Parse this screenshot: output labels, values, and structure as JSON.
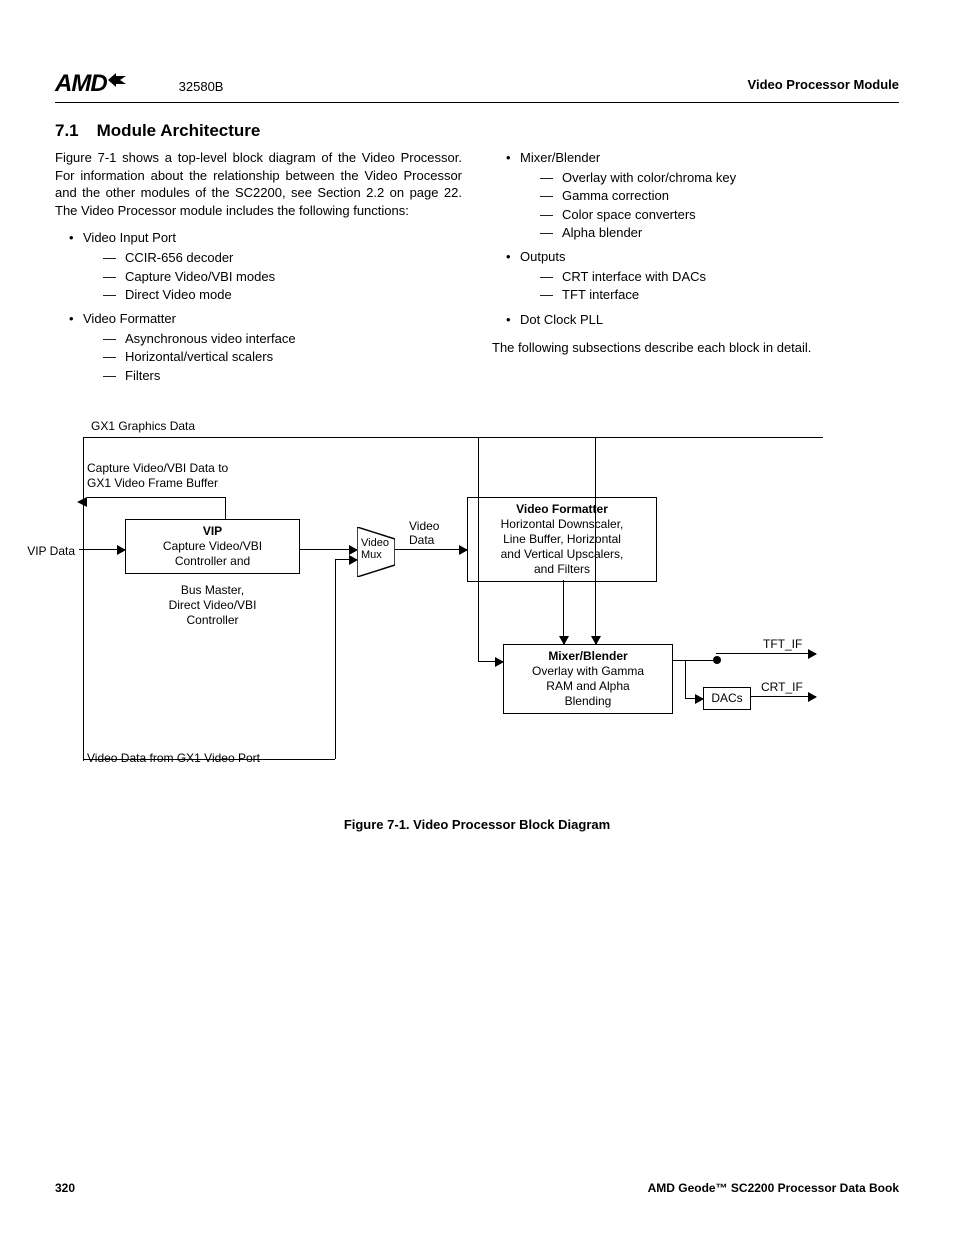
{
  "header": {
    "logo": "AMD",
    "docnum": "32580B",
    "module": "Video Processor Module"
  },
  "section": {
    "num": "7.1",
    "title": "Module Architecture",
    "intro": "Figure 7-1 shows a top-level block diagram of the Video Processor. For information about the relationship between the Video Processor and the other modules of the SC2200, see Section 2.2 on page 22. The Video Processor module includes the following functions:",
    "col1": [
      {
        "head": "Video Input Port",
        "subs": [
          "CCIR-656 decoder",
          "Capture Video/VBI modes",
          "Direct Video mode"
        ]
      },
      {
        "head": "Video Formatter",
        "subs": [
          "Asynchronous video interface",
          "Horizontal/vertical scalers",
          "Filters"
        ]
      }
    ],
    "col2": [
      {
        "head": "Mixer/Blender",
        "subs": [
          "Overlay with color/chroma key",
          "Gamma correction",
          "Color space converters",
          "Alpha blender"
        ]
      },
      {
        "head": "Outputs",
        "subs": [
          "CRT interface with DACs",
          "TFT interface"
        ]
      },
      {
        "head": "Dot Clock PLL",
        "subs": []
      }
    ],
    "followup": "The following subsections describe each block in detail."
  },
  "diagram": {
    "top_label": "GX1 Graphics Data",
    "capture_label_l1": "Capture Video/VBI Data to",
    "capture_label_l2": "GX1 Video Frame Buffer",
    "vip_data": "VIP Data",
    "vip_title": "VIP",
    "vip_l1": "Capture Video/VBI",
    "vip_l2": "Controller and",
    "vip_extra_l1": "Bus Master,",
    "vip_extra_l2": "Direct Video/VBI",
    "vip_extra_l3": "Controller",
    "mux_l1": "Video",
    "mux_l2": "Mux",
    "video_data_l1": "Video",
    "video_data_l2": "Data",
    "fmt_title": "Video Formatter",
    "fmt_l1": "Horizontal Downscaler,",
    "fmt_l2": "Line Buffer, Horizontal",
    "fmt_l3": "and Vertical Upscalers,",
    "fmt_l4": "and Filters",
    "mixer_title": "Mixer/Blender",
    "mixer_l1": "Overlay with Gamma",
    "mixer_l2": "RAM and Alpha",
    "mixer_l3": "Blending",
    "dacs": "DACs",
    "tft": "TFT_IF",
    "crt": "CRT_IF",
    "bottom_label": "Video Data from GX1 Video Port"
  },
  "figure_caption": "Figure 7-1.  Video Processor Block Diagram",
  "footer": {
    "page": "320",
    "book": "AMD Geode™ SC2200  Processor Data Book"
  }
}
